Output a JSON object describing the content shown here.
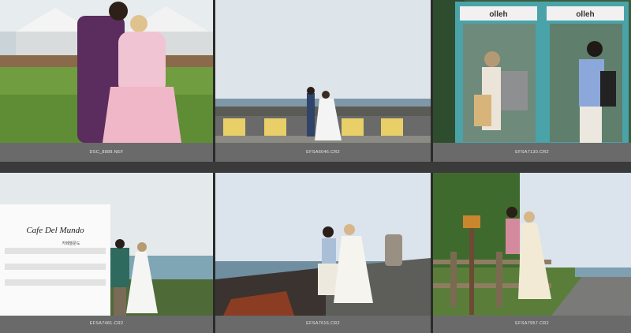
{
  "photos": [
    {
      "filename": "DSC_8888.NEF"
    },
    {
      "filename": "EFSA6046.CR2"
    },
    {
      "filename": "EFSA7130.CR2"
    },
    {
      "filename": "EFSA7481.CR2"
    },
    {
      "filename": "EFSA7616.CR2"
    },
    {
      "filename": "EFSA7957.CR2"
    }
  ],
  "signs": {
    "booth_left": "olleh",
    "booth_right": "olleh",
    "cafe": "Cafe Del Mundo",
    "cafe_sub": "카페델문도"
  }
}
